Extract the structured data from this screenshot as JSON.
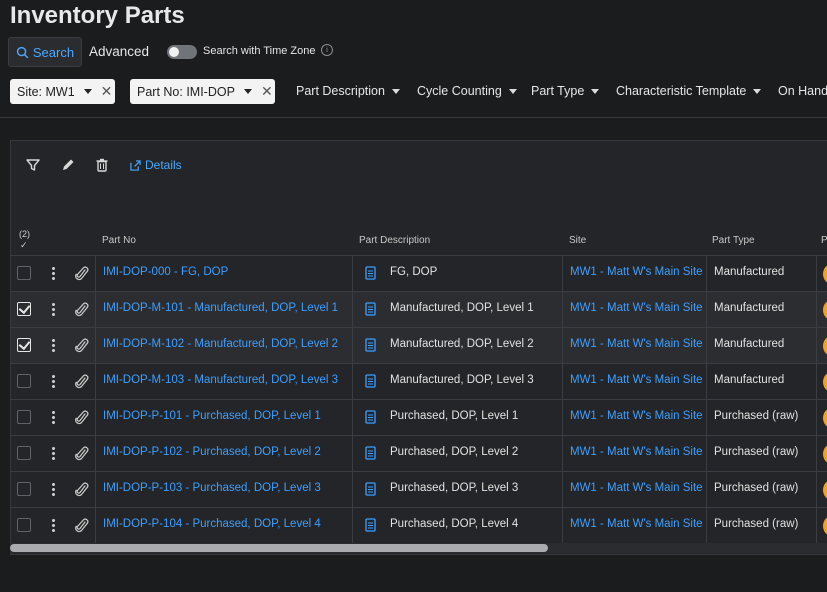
{
  "page": {
    "title": "Inventory Parts"
  },
  "search": {
    "search_label": "Search",
    "advanced_label": "Advanced",
    "time_zone_label": "Search with Time Zone",
    "time_zone_enabled": false
  },
  "filters": {
    "chips": [
      {
        "label": "Site: MW1"
      },
      {
        "label": "Part No: IMI-DOP"
      }
    ],
    "menus": [
      {
        "label": "Part Description"
      },
      {
        "label": "Cycle Counting"
      },
      {
        "label": "Part Type"
      },
      {
        "label": "Characteristic Template"
      },
      {
        "label": "On Hand"
      }
    ]
  },
  "toolbar": {
    "filter_icon": "funnel-icon",
    "edit_icon": "pencil-icon",
    "delete_icon": "trash-icon",
    "details_label": "Details"
  },
  "grid": {
    "selected_count": "(2)",
    "columns": {
      "part_no": "Part No",
      "part_description": "Part Description",
      "site": "Site",
      "part_type": "Part Type",
      "next": "P"
    },
    "rows": [
      {
        "checked": false,
        "part_no": "IMI-DOP-000 - FG, DOP",
        "description": "FG, DOP",
        "site": "MW1 - Matt W's Main Site",
        "part_type": "Manufactured"
      },
      {
        "checked": true,
        "part_no": "IMI-DOP-M-101 - Manufactured, DOP, Level 1",
        "description": "Manufactured, DOP, Level 1",
        "site": "MW1 - Matt W's Main Site",
        "part_type": "Manufactured"
      },
      {
        "checked": true,
        "part_no": "IMI-DOP-M-102 - Manufactured, DOP, Level 2",
        "description": "Manufactured, DOP, Level 2",
        "site": "MW1 - Matt W's Main Site",
        "part_type": "Manufactured"
      },
      {
        "checked": false,
        "part_no": "IMI-DOP-M-103 - Manufactured, DOP, Level 3",
        "description": "Manufactured, DOP, Level 3",
        "site": "MW1 - Matt W's Main Site",
        "part_type": "Manufactured"
      },
      {
        "checked": false,
        "part_no": "IMI-DOP-P-101 - Purchased, DOP, Level 1",
        "description": "Purchased, DOP, Level 1",
        "site": "MW1 - Matt W's Main Site",
        "part_type": "Purchased (raw)"
      },
      {
        "checked": false,
        "part_no": "IMI-DOP-P-102 - Purchased, DOP, Level 2",
        "description": "Purchased, DOP, Level 2",
        "site": "MW1 - Matt W's Main Site",
        "part_type": "Purchased (raw)"
      },
      {
        "checked": false,
        "part_no": "IMI-DOP-P-103 - Purchased, DOP, Level 3",
        "description": "Purchased, DOP, Level 3",
        "site": "MW1 - Matt W's Main Site",
        "part_type": "Purchased (raw)"
      },
      {
        "checked": false,
        "part_no": "IMI-DOP-P-104 - Purchased, DOP, Level 4",
        "description": "Purchased, DOP, Level 4",
        "site": "MW1 - Matt W's Main Site",
        "part_type": "Purchased (raw)"
      }
    ]
  },
  "colors": {
    "accent": "#3d9fff",
    "status": "#f0a323",
    "background": "#1b1c1e"
  }
}
